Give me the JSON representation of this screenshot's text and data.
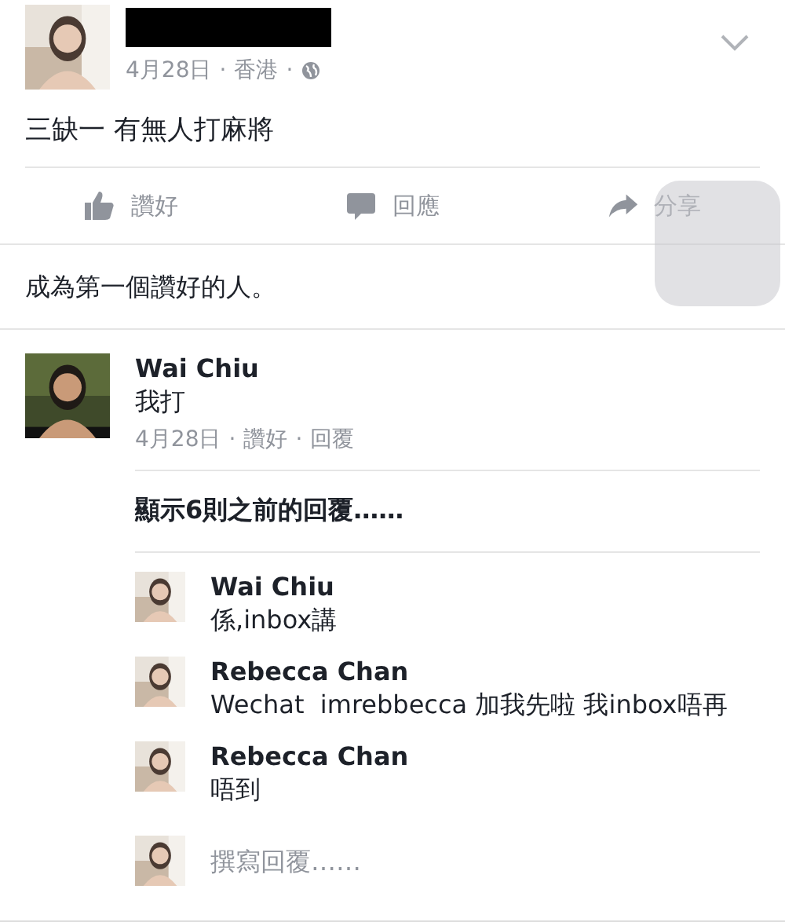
{
  "post": {
    "author": {
      "redacted": true
    },
    "meta": [
      "4月28日",
      "·",
      "香港",
      "·"
    ],
    "text": "三缺一 有無人打麻將"
  },
  "actions": [
    {
      "kind": "like",
      "label": "讚好"
    },
    {
      "kind": "comment",
      "label": "回應"
    },
    {
      "kind": "share",
      "label": "分享"
    }
  ],
  "likes_prompt": "成為第一個讚好的人。",
  "comment": {
    "author": "Wai Chiu",
    "text": "我打",
    "meta": [
      "4月28日",
      "·",
      "讚好",
      "·",
      "回覆"
    ]
  },
  "more_replies": "顯示6則之前的回覆……",
  "replies": [
    {
      "author": "Wai Chiu",
      "text": "係,inbox講"
    },
    {
      "author": "Rebecca Chan",
      "text": "Wechat  imrebbecca 加我先啦 我inbox唔再"
    },
    {
      "author": "Rebecca Chan",
      "text": "唔到"
    }
  ],
  "composer": {
    "placeholder": "撰寫回覆……"
  },
  "assistive_touch": true
}
